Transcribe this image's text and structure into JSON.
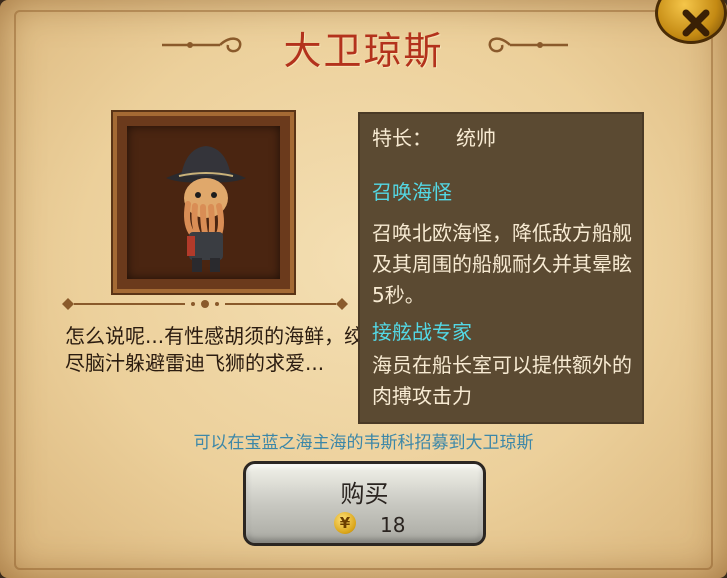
{
  "title": "大卫琼斯",
  "description": "怎么说呢...有性感胡须的海鲜，绞尽脑汁躲避雷迪飞狮的求爱...",
  "specialty": {
    "label": "特长：",
    "value": "统帅"
  },
  "skills": [
    {
      "name": "召唤海怪",
      "desc": "召唤北欧海怪，降低敌方船舰及其周围的船舰耐久并其晕眩5秒。"
    },
    {
      "name": "接舷战专家",
      "desc": "海员在船长室可以提供额外的肉搏攻击力"
    }
  ],
  "recruit_note": "可以在宝蓝之海主海的韦斯科招募到大卫琼斯",
  "buy": {
    "label": "购买",
    "currency_symbol": "¥",
    "price": "18"
  },
  "icons": {
    "close": "close-icon",
    "currency": "yuan-coin-icon"
  },
  "colors": {
    "title": "#b3321c",
    "skill_name": "#53d9e6",
    "recruit_note": "#3c87a8"
  }
}
